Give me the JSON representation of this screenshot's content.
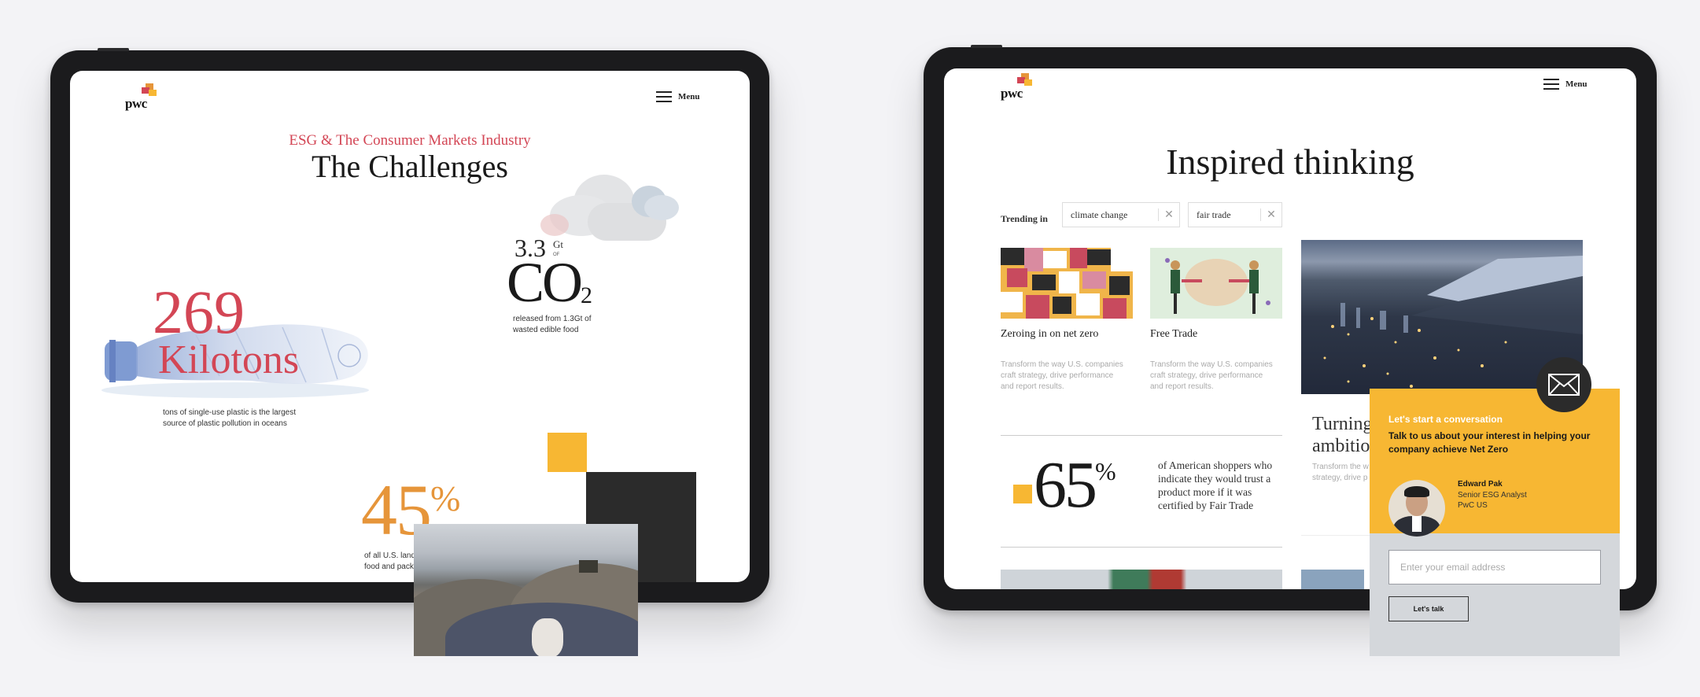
{
  "left_tablet": {
    "logo_text": "pwc",
    "menu_label": "Menu",
    "kicker": "ESG & The Consumer Markets Industry",
    "title": "The Challenges",
    "co2_stat": {
      "value": "3.3",
      "unit": "Gt",
      "of": "OF",
      "compound": "CO",
      "subscript": "2",
      "description": "released from 1.3Gt of wasted edible food"
    },
    "plastic_stat": {
      "value": "269",
      "unit": "Kilotons",
      "description": "tons of single-use plastic is the largest source of plastic pollution in oceans"
    },
    "landfill_stat": {
      "value": "45",
      "unit": "%",
      "description": "of all U.S. landfills are made up of food and packaging"
    }
  },
  "right_tablet": {
    "logo_text": "pwc",
    "menu_label": "Menu",
    "title": "Inspired thinking",
    "trending_label": "Trending in",
    "chips": [
      {
        "label": "climate change"
      },
      {
        "label": "fair trade"
      }
    ],
    "cards": [
      {
        "title": "Zeroing in on net zero",
        "description": "Transform the way U.S. companies craft strategy, drive performance and report results."
      },
      {
        "title": "Free Trade",
        "description": "Transform the way U.S. companies craft strategy, drive performance and report results."
      }
    ],
    "featured": {
      "title": "Turning ambition",
      "description": "Transform the w strategy, drive p"
    },
    "stat": {
      "value": "65",
      "unit": "%",
      "description": "of American shoppers who indicate they would trust a product more if it was certified by Fair Trade"
    }
  },
  "contact_popup": {
    "lead": "Let's start a conversation",
    "message": "Talk to us about your interest in helping your company achieve Net Zero",
    "person_name": "Edward Pak",
    "person_title": "Senior ESG Analyst",
    "person_company": "PwC US",
    "email_placeholder": "Enter your email address",
    "button_label": "Let's talk"
  },
  "colors": {
    "background": "#f3f3f6",
    "pwc_red": "#d34655",
    "pwc_orange": "#e6953a",
    "pwc_yellow": "#f7b733",
    "dark": "#2b2b2b",
    "popup_gray": "#d4d7db"
  },
  "icons": [
    "pwc-logo-icon",
    "hamburger-menu-icon",
    "close-icon",
    "envelope-icon",
    "cloud-icon",
    "plastic-bottle-icon"
  ]
}
